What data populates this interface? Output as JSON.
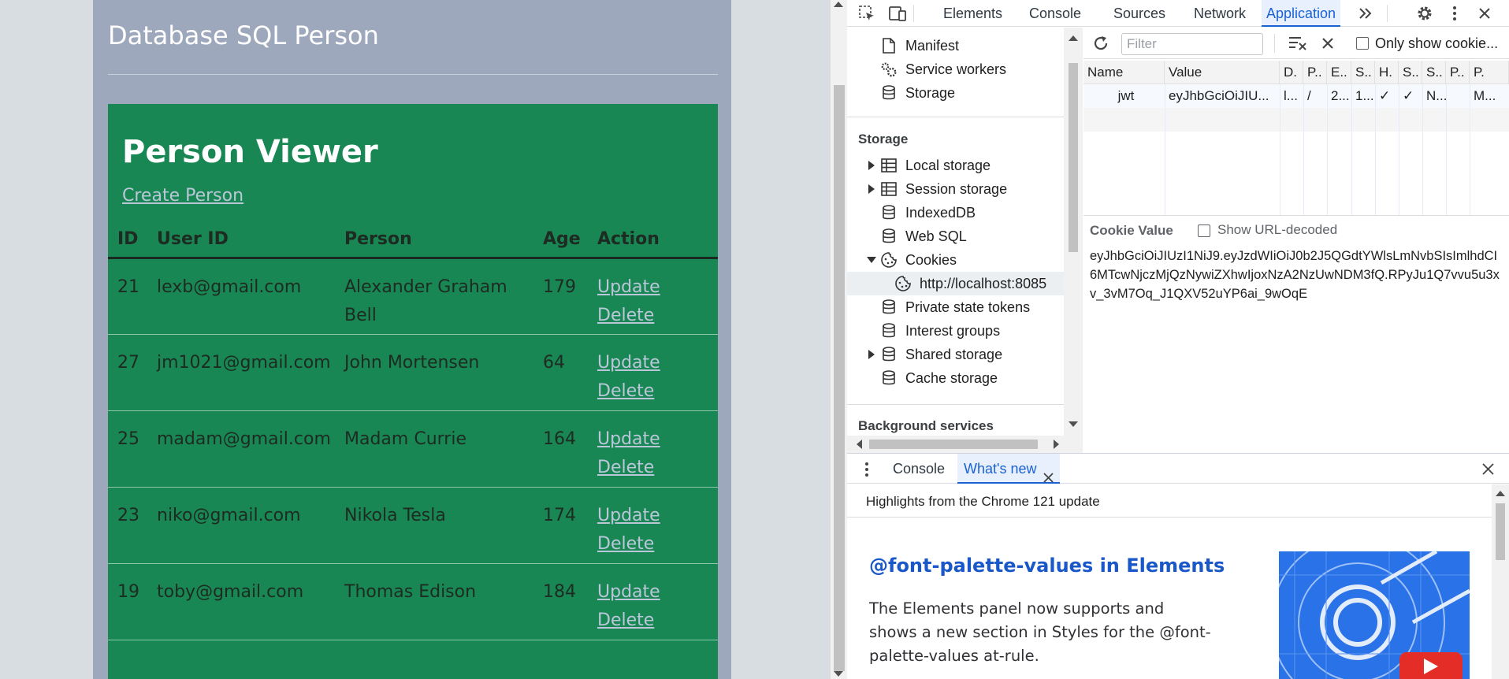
{
  "page": {
    "title": "Database SQL Person",
    "viewer_title": "Person Viewer",
    "create_link": "Create Person",
    "table": {
      "headers": [
        "ID",
        "User ID",
        "Person",
        "Age",
        "Action"
      ],
      "rows": [
        {
          "id": "21",
          "user_id": "lexb@gmail.com",
          "person": "Alexander Graham Bell",
          "age": "179",
          "update": "Update",
          "delete": "Delete"
        },
        {
          "id": "27",
          "user_id": "jm1021@gmail.com",
          "person": "John Mortensen",
          "age": "64",
          "update": "Update",
          "delete": "Delete"
        },
        {
          "id": "25",
          "user_id": "madam@gmail.com",
          "person": "Madam Currie",
          "age": "164",
          "update": "Update",
          "delete": "Delete"
        },
        {
          "id": "23",
          "user_id": "niko@gmail.com",
          "person": "Nikola Tesla",
          "age": "174",
          "update": "Update",
          "delete": "Delete"
        },
        {
          "id": "19",
          "user_id": "toby@gmail.com",
          "person": "Thomas Edison",
          "age": "184",
          "update": "Update",
          "delete": "Delete"
        }
      ]
    },
    "colors": {
      "card": "#9ea8bc",
      "viewer": "#198754",
      "link": "#b9c7d9"
    }
  },
  "devtools": {
    "tabs": [
      "Elements",
      "Console",
      "Sources",
      "Network",
      "Application"
    ],
    "active_tab": "Application",
    "more_tabs_icon": "chevron-double-right-icon",
    "tree": {
      "top_items": [
        {
          "label": "Manifest",
          "icon": "file-icon"
        },
        {
          "label": "Service workers",
          "icon": "gears-icon"
        },
        {
          "label": "Storage",
          "icon": "database-icon"
        }
      ],
      "storage_heading": "Storage",
      "storage_items": [
        {
          "label": "Local storage",
          "icon": "table-icon",
          "expandable": true
        },
        {
          "label": "Session storage",
          "icon": "table-icon",
          "expandable": true
        },
        {
          "label": "IndexedDB",
          "icon": "database-icon",
          "expandable": false
        },
        {
          "label": "Web SQL",
          "icon": "database-icon",
          "expandable": false
        },
        {
          "label": "Cookies",
          "icon": "cookie-icon",
          "expandable": true,
          "expanded": true
        },
        {
          "label": "http://localhost:8085",
          "icon": "cookie-icon",
          "child": true,
          "selected": true
        },
        {
          "label": "Private state tokens",
          "icon": "database-icon",
          "expandable": false
        },
        {
          "label": "Interest groups",
          "icon": "database-icon",
          "expandable": false
        },
        {
          "label": "Shared storage",
          "icon": "database-icon",
          "expandable": true
        },
        {
          "label": "Cache storage",
          "icon": "database-icon",
          "expandable": false
        }
      ],
      "background_heading": "Background services"
    },
    "cookies": {
      "filter_placeholder": "Filter",
      "only_show_label": "Only show cookie...",
      "columns": [
        "Name",
        "Value",
        "D.",
        "P..",
        "E..",
        "S..",
        "H.",
        "S..",
        "S..",
        "P..",
        "P."
      ],
      "row": [
        "jwt",
        "eyJhbGciOiJIU...",
        "l...",
        "/",
        "2...",
        "1...",
        "✓",
        "✓",
        "N...",
        "",
        "M..."
      ],
      "value_heading": "Cookie Value",
      "url_decoded_label": "Show URL-decoded",
      "value": "eyJhbGciOiJIUzI1NiJ9.eyJzdWIiOiJ0b2J5QGdtYWlsLmNvbSIsImlhdCI6MTcwNjczMjQzNywiZXhwIjoxNzA2NzUwNDM3fQ.RPyJu1Q7vvu5u3xv_3vM7Oq_J1QXV52uYP6ai_9wOqE"
    },
    "drawer": {
      "tabs": [
        "Console",
        "What's new"
      ],
      "active_tab": "What's new",
      "highlights": "Highlights from the Chrome 121 update",
      "feature_title": "@font-palette-values in Elements",
      "feature_body": "The Elements panel now supports and shows a new section in Styles for the @font-palette-values at-rule."
    }
  }
}
